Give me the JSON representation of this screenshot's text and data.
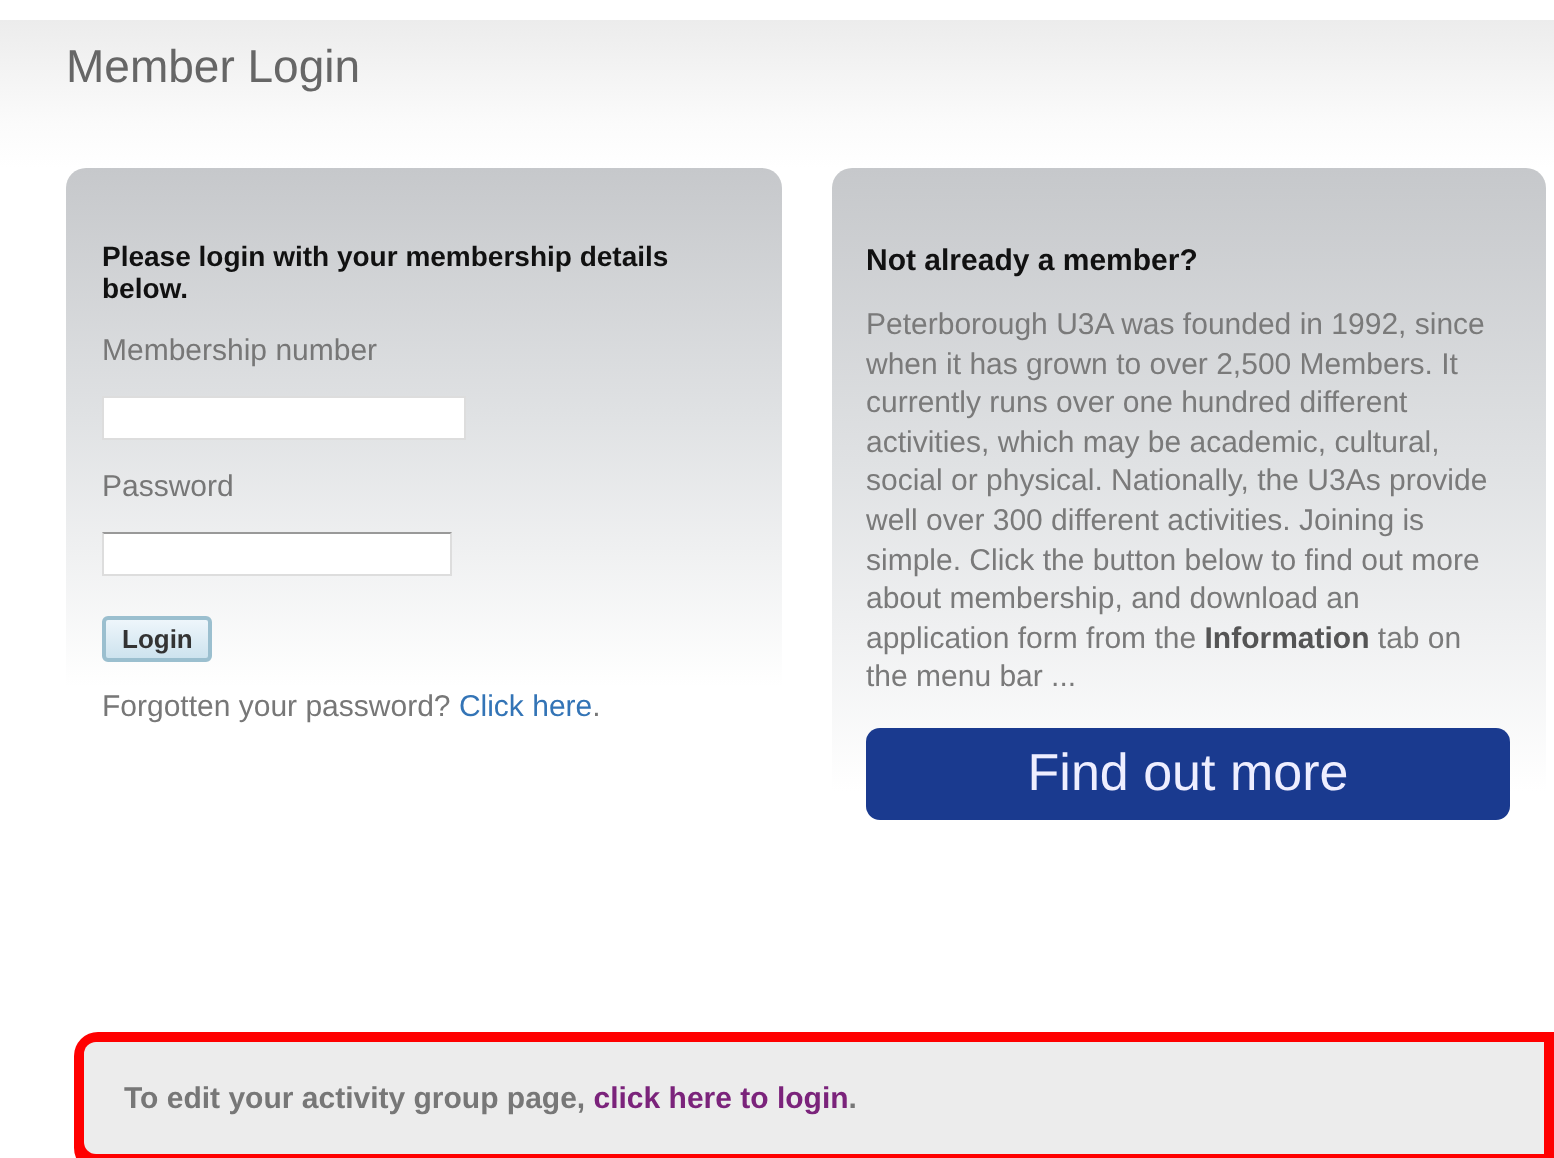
{
  "page_title": "Member Login",
  "login_panel": {
    "heading": "Please login with your membership details below.",
    "fields": [
      {
        "label": "Membership number",
        "kind": "text"
      },
      {
        "label": "Password",
        "kind": "password"
      }
    ],
    "button": "Login",
    "forgot": {
      "text": "Forgotten your password?",
      "link": "Click here",
      "suffix": "."
    }
  },
  "join_panel": {
    "heading": "Not already a member?",
    "body": "Peterborough U3A was founded in 1992, since when it has grown to over 2,500 Members. It currently runs over one hundred different activities, which may be academic, cultural, social or physical. Nationally, the U3As provide well over 300 different activities. Joining is simple. Click the button below to find out more about membership, and download an application form from the **Information** tab on the menu bar ...",
    "button": "Find out more"
  },
  "notice": {
    "text": "To edit your activity group page,",
    "link": "click here to login",
    "suffix": ".",
    "highlighted": true
  }
}
